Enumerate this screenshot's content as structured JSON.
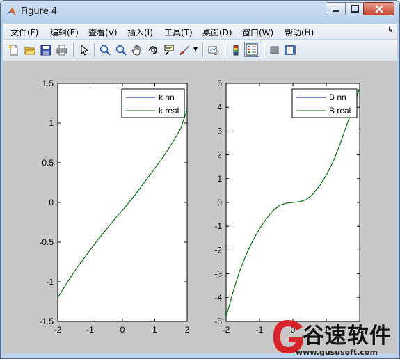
{
  "window": {
    "title": "Figure 4"
  },
  "menu": [
    {
      "label": "文件(F)"
    },
    {
      "label": "编辑(E)"
    },
    {
      "label": "查看(V)"
    },
    {
      "label": "插入(I)"
    },
    {
      "label": "工具(T)"
    },
    {
      "label": "桌面(D)"
    },
    {
      "label": "窗口(W)"
    },
    {
      "label": "帮助(H)"
    }
  ],
  "toolbar": {
    "icons": [
      "new-figure-icon",
      "open-file-icon",
      "save-icon",
      "print-icon",
      "pointer-icon",
      "zoom-in-icon",
      "zoom-out-icon",
      "pan-hand-icon",
      "rotate-3d-icon",
      "data-cursor-icon",
      "brush-icon",
      "link-plot-icon",
      "colorbar-icon",
      "legend-icon",
      "hide-plot-tools-icon",
      "show-plot-tools-icon"
    ],
    "pressed": "legend-icon"
  },
  "colors": {
    "series_nn": "#00007f",
    "series_real": "#007f00",
    "figure_bg": "#c8c8c8",
    "axes_bg": "#ffffff"
  },
  "watermark": {
    "text": "谷速软件",
    "url": "www.gususoft.com"
  },
  "chart_data": [
    {
      "type": "line",
      "title": "",
      "xlabel": "",
      "ylabel": "",
      "xlim": [
        -2,
        2
      ],
      "ylim": [
        -1.5,
        1.5
      ],
      "xticks": [
        "-2",
        "-1",
        "0",
        "1",
        "2"
      ],
      "yticks": [
        "1.5",
        "1",
        "0.5",
        "0",
        "-0.5",
        "-1",
        "-1.5"
      ],
      "legend": {
        "placement": "top-right",
        "entries": [
          "k nn",
          "k real"
        ]
      },
      "x": [
        -2,
        -1.8,
        -1.6,
        -1.4,
        -1.2,
        -1,
        -0.8,
        -0.6,
        -0.4,
        -0.2,
        0,
        0.2,
        0.4,
        0.6,
        0.8,
        1,
        1.2,
        1.4,
        1.6,
        1.8,
        2
      ],
      "series": [
        {
          "name": "k nn",
          "values": [
            -1.2,
            -1.07,
            -0.94,
            -0.82,
            -0.71,
            -0.6,
            -0.49,
            -0.39,
            -0.29,
            -0.19,
            -0.1,
            0.0,
            0.1,
            0.21,
            0.32,
            0.43,
            0.54,
            0.66,
            0.79,
            0.93,
            1.17
          ]
        },
        {
          "name": "k real",
          "values": [
            -1.2,
            -1.07,
            -0.94,
            -0.82,
            -0.71,
            -0.6,
            -0.49,
            -0.39,
            -0.29,
            -0.19,
            -0.1,
            0.0,
            0.1,
            0.21,
            0.32,
            0.43,
            0.54,
            0.66,
            0.79,
            0.93,
            1.17
          ]
        }
      ]
    },
    {
      "type": "line",
      "title": "",
      "xlabel": "",
      "ylabel": "",
      "xlim": [
        -2,
        2
      ],
      "ylim": [
        -5,
        5
      ],
      "xticks": [
        "-2",
        "-1",
        "0",
        "1",
        "2"
      ],
      "yticks": [
        "5",
        "4",
        "3",
        "2",
        "1",
        "0",
        "-1",
        "-2",
        "-3",
        "-4",
        "-5"
      ],
      "legend": {
        "placement": "top-right",
        "entries": [
          "B nn",
          "B real"
        ]
      },
      "x": [
        -2,
        -1.8,
        -1.6,
        -1.4,
        -1.2,
        -1,
        -0.8,
        -0.6,
        -0.4,
        -0.2,
        0,
        0.2,
        0.4,
        0.6,
        0.8,
        1,
        1.2,
        1.4,
        1.6,
        1.8,
        2
      ],
      "series": [
        {
          "name": "B nn",
          "values": [
            -4.8,
            -3.8,
            -2.9,
            -2.2,
            -1.6,
            -1.1,
            -0.7,
            -0.35,
            -0.12,
            -0.03,
            0,
            0.03,
            0.12,
            0.35,
            0.7,
            1.15,
            1.7,
            2.4,
            3.2,
            4.0,
            4.8
          ]
        },
        {
          "name": "B real",
          "values": [
            -4.8,
            -3.8,
            -2.9,
            -2.2,
            -1.6,
            -1.1,
            -0.7,
            -0.35,
            -0.12,
            -0.03,
            0,
            0.03,
            0.12,
            0.35,
            0.7,
            1.15,
            1.7,
            2.4,
            3.2,
            4.0,
            4.8
          ]
        }
      ]
    }
  ]
}
